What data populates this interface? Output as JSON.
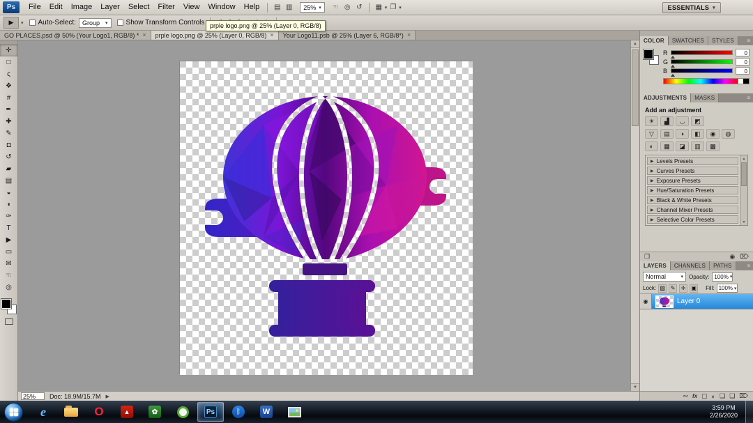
{
  "app": {
    "logo": "Ps"
  },
  "menubar": {
    "items": [
      "File",
      "Edit",
      "Image",
      "Layer",
      "Select",
      "Filter",
      "View",
      "Window",
      "Help"
    ],
    "bridge_icon": "▤",
    "extras_icon": "▥",
    "zoom_value": "25%",
    "hand_icon": "☜",
    "zoom_icon": "◎",
    "rotate_icon": "↺",
    "arrange_icon": "▦",
    "screen_icon": "❐",
    "caret": "▾",
    "workspace": "ESSENTIALS"
  },
  "options": {
    "tool_icon": "▶",
    "caret": "▾",
    "auto_select_label": "Auto-Select:",
    "auto_select_value": "Group",
    "show_transform_label": "Show Transform Controls",
    "align_icons": [
      "╟",
      "╫",
      "╢",
      "╤",
      "╪",
      "╧"
    ],
    "extra_icons": [
      "▦",
      "▧"
    ]
  },
  "tooltip": {
    "text": "prple logo.png @ 25% (Layer 0, RGB/8)"
  },
  "doc_tabs": [
    {
      "label": "GO PLACES.psd @ 50% (Your Logo1, RGB/8) *",
      "close": "×"
    },
    {
      "label": "prple logo.png @ 25% (Layer 0, RGB/8)",
      "close": "×"
    },
    {
      "label": "Your Logo11.psb @ 25% (Layer 6, RGB/8*)",
      "close": "×"
    }
  ],
  "tools": [
    {
      "name": "move-tool",
      "glyph": "✛"
    },
    {
      "name": "marquee-tool",
      "glyph": "□"
    },
    {
      "name": "lasso-tool",
      "glyph": "ς"
    },
    {
      "name": "quick-selection-tool",
      "glyph": "❖"
    },
    {
      "name": "crop-tool",
      "glyph": "#"
    },
    {
      "name": "eyedropper-tool",
      "glyph": "✒"
    },
    {
      "name": "healing-brush-tool",
      "glyph": "✚"
    },
    {
      "name": "brush-tool",
      "glyph": "✎"
    },
    {
      "name": "clone-stamp-tool",
      "glyph": "◘"
    },
    {
      "name": "history-brush-tool",
      "glyph": "↺"
    },
    {
      "name": "eraser-tool",
      "glyph": "▰"
    },
    {
      "name": "gradient-tool",
      "glyph": "▤"
    },
    {
      "name": "blur-tool",
      "glyph": "◒"
    },
    {
      "name": "dodge-tool",
      "glyph": "◖"
    },
    {
      "name": "pen-tool",
      "glyph": "✑"
    },
    {
      "name": "type-tool",
      "glyph": "T"
    },
    {
      "name": "path-selection-tool",
      "glyph": "▶"
    },
    {
      "name": "rectangle-tool",
      "glyph": "▭"
    },
    {
      "name": "notes-tool",
      "glyph": "✉"
    },
    {
      "name": "hand-tool",
      "glyph": "☜"
    },
    {
      "name": "zoom-tool",
      "glyph": "◎"
    }
  ],
  "color_panel": {
    "tabs": [
      "COLOR",
      "SWATCHES",
      "STYLES"
    ],
    "menu_icon": "≡",
    "channels": [
      {
        "label": "R",
        "value": "0"
      },
      {
        "label": "G",
        "value": "0"
      },
      {
        "label": "B",
        "value": "0"
      }
    ]
  },
  "adjustments": {
    "tabs": [
      "ADJUSTMENTS",
      "MASKS"
    ],
    "menu_icon": "≡",
    "header": "Add an adjustment",
    "row1": [
      {
        "name": "brightness-contrast-icon",
        "glyph": "☀"
      },
      {
        "name": "levels-icon",
        "glyph": "▟"
      },
      {
        "name": "curves-icon",
        "glyph": "◡"
      },
      {
        "name": "exposure-icon",
        "glyph": "◩"
      }
    ],
    "row2": [
      {
        "name": "vibrance-icon",
        "glyph": "▽"
      },
      {
        "name": "hue-saturation-icon",
        "glyph": "▤"
      },
      {
        "name": "color-balance-icon",
        "glyph": "◑"
      },
      {
        "name": "black-white-icon",
        "glyph": "◧"
      },
      {
        "name": "photo-filter-icon",
        "glyph": "◉"
      },
      {
        "name": "channel-mixer-icon",
        "glyph": "◍"
      }
    ],
    "row3": [
      {
        "name": "invert-icon",
        "glyph": "◐"
      },
      {
        "name": "posterize-icon",
        "glyph": "▦"
      },
      {
        "name": "threshold-icon",
        "glyph": "◪"
      },
      {
        "name": "gradient-map-icon",
        "glyph": "▥"
      },
      {
        "name": "selective-color-icon",
        "glyph": "▩"
      }
    ],
    "expander": "▶",
    "presets": [
      {
        "label": "Levels Presets"
      },
      {
        "label": "Curves Presets"
      },
      {
        "label": "Exposure Presets"
      },
      {
        "label": "Hue/Saturation Presets"
      },
      {
        "label": "Black & White Presets"
      },
      {
        "label": "Channel Mixer Presets"
      },
      {
        "label": "Selective Color Presets"
      }
    ],
    "footer": {
      "expand_icon": "❐",
      "eye_icon": "◉",
      "delete_icon": "⌦"
    }
  },
  "layers": {
    "tabs": [
      "LAYERS",
      "CHANNELS",
      "PATHS"
    ],
    "menu_icon": "≡",
    "blend_mode": "Normal",
    "caret": "▾",
    "opacity_label": "Opacity:",
    "opacity_value": "100%",
    "lock_label": "Lock:",
    "lock_icons": [
      {
        "name": "lock-transparent-icon",
        "glyph": "▨"
      },
      {
        "name": "lock-pixels-icon",
        "glyph": "✎"
      },
      {
        "name": "lock-position-icon",
        "glyph": "✛"
      },
      {
        "name": "lock-all-icon",
        "glyph": "▣"
      }
    ],
    "fill_label": "Fill:",
    "fill_value": "100%",
    "rows": [
      {
        "name": "Layer 0",
        "eye": "◉"
      }
    ],
    "footer_icons": [
      {
        "name": "link-layers-icon",
        "glyph": "∾"
      },
      {
        "name": "layer-style-icon",
        "glyph": "fx"
      },
      {
        "name": "layer-mask-icon",
        "glyph": "▢"
      },
      {
        "name": "adjustment-layer-icon",
        "glyph": "◐"
      },
      {
        "name": "layer-group-icon",
        "glyph": "❑"
      },
      {
        "name": "new-layer-icon",
        "glyph": "❏"
      },
      {
        "name": "delete-layer-icon",
        "glyph": "⌦"
      }
    ]
  },
  "status": {
    "zoom": "25%",
    "doc": "Doc: 18.9M/15.7M",
    "arrow": "▶"
  },
  "scrollbar": {
    "up": "▲",
    "down": "▼"
  },
  "taskbar": {
    "apps": [
      {
        "name": "internet-explorer",
        "glyph": "e"
      },
      {
        "name": "file-explorer",
        "glyph": ""
      },
      {
        "name": "opera",
        "glyph": "O"
      },
      {
        "name": "adobe-reader",
        "glyph": "▲"
      },
      {
        "name": "green-app",
        "glyph": "✿"
      },
      {
        "name": "media-app",
        "glyph": ""
      },
      {
        "name": "photoshop",
        "glyph": "Ps"
      },
      {
        "name": "bluetooth",
        "glyph": "ᛒ"
      },
      {
        "name": "word",
        "glyph": "W"
      },
      {
        "name": "photo-viewer",
        "glyph": ""
      }
    ],
    "clock_time": "3:59 PM",
    "clock_date": "2/26/2020"
  }
}
